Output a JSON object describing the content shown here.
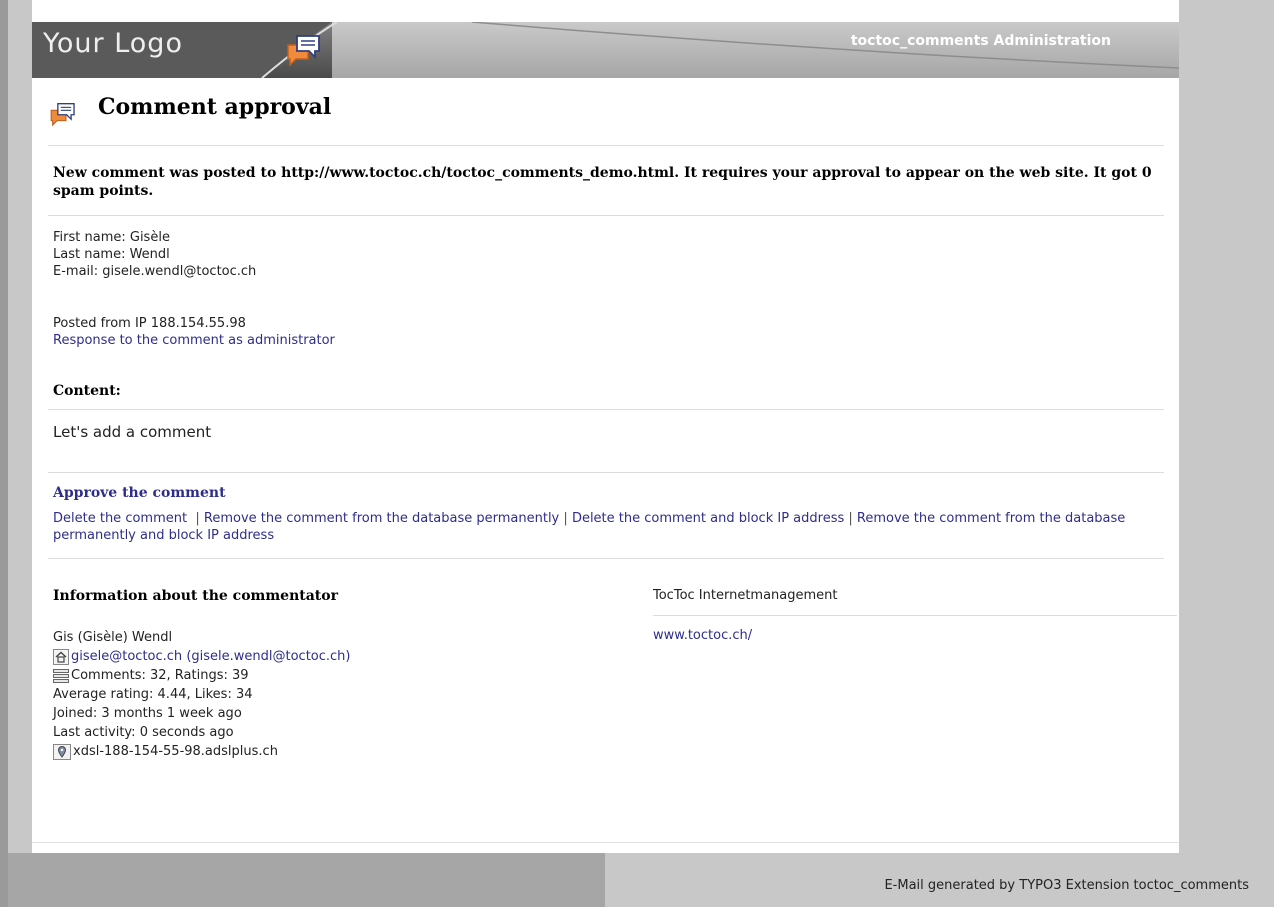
{
  "header": {
    "logo": "Your Logo",
    "title": "toctoc_comments Administration"
  },
  "page": {
    "title": "Comment approval",
    "notice": "New comment was posted to http://www.toctoc.ch/toctoc_comments_demo.html. It requires your approval to appear on the web site. It got 0 spam points."
  },
  "submitter": {
    "first_name": "First name: Gisèle",
    "last_name": "Last name: Wendl",
    "email": "E-mail: gisele.wendl@toctoc.ch",
    "ip": "Posted from IP 188.154.55.98",
    "respond_link": "Response to the comment as administrator"
  },
  "comment": {
    "label": "Content:",
    "text": "Let's add a comment"
  },
  "actions": {
    "approve": "Approve the comment",
    "delete": "Delete the comment",
    "remove": "Remove the comment from the database permanently",
    "delete_block": "Delete the comment and block IP address",
    "remove_block": "Remove the comment from the database permanently and block IP address",
    "separator": "|"
  },
  "commentator": {
    "heading": "Information about the commentator",
    "name": "Gis (Gisèle) Wendl",
    "email_link": "gisele@toctoc.ch",
    "email_full": "(gisele.wendl@toctoc.ch)",
    "stats": "Comments: 32, Ratings: 39",
    "rating": "Average rating: 4.44, Likes: 34",
    "joined": "Joined: 3 months 1 week ago",
    "last_activity": "Last activity: 0 seconds ago",
    "host": "xdsl-188-154-55-98.adslplus.ch"
  },
  "company": {
    "name": "TocToc Internetmanagement",
    "url": "www.toctoc.ch/"
  },
  "footer": {
    "text": "E-Mail generated by TYPO3 Extension toctoc_comments"
  },
  "icons": {
    "header": "comment-bubbles-icon",
    "title": "comment-bubbles-icon",
    "home": "home-icon",
    "stats": "list-icon",
    "location": "location-icon"
  },
  "colors": {
    "link": "#2e2e8a",
    "accent": "#f08a3c",
    "header_dark": "#4a4a4a"
  }
}
